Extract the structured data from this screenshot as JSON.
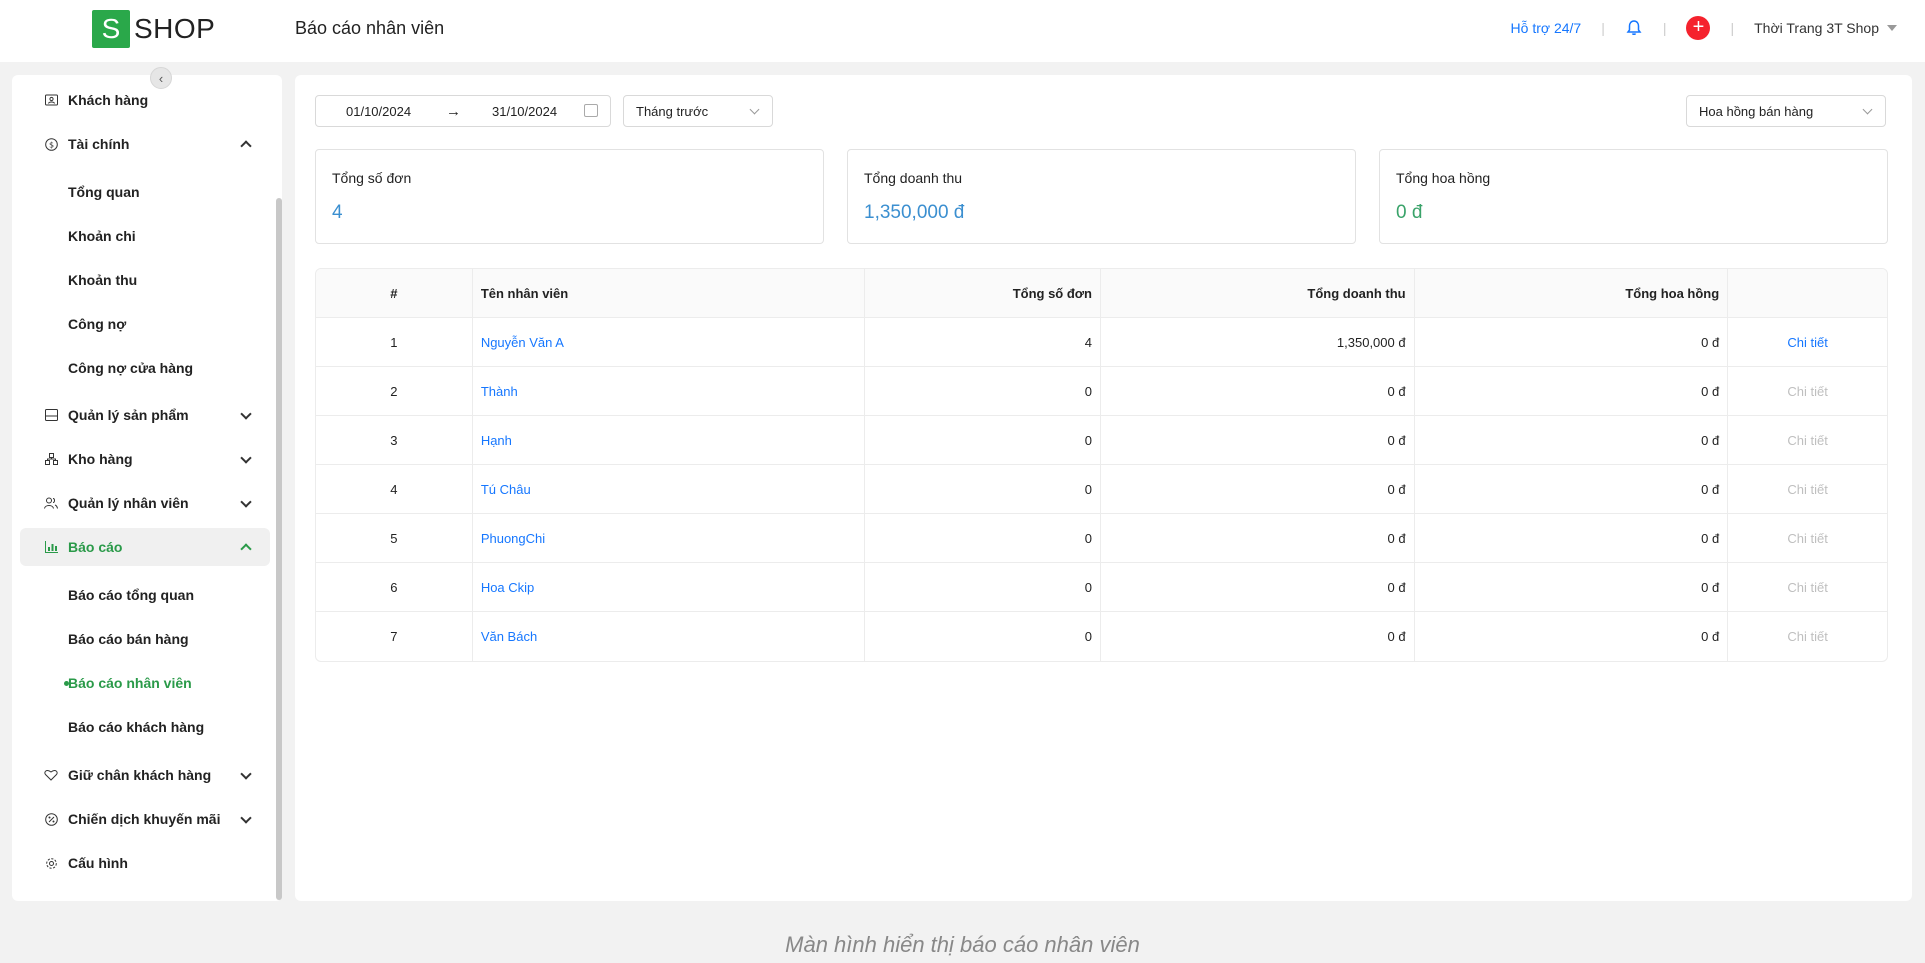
{
  "header": {
    "logo_letter": "S",
    "logo_text": "SHOP",
    "page_title": "Báo cáo nhân viên",
    "support": "Hỗ trợ 24/7",
    "separator": "|",
    "plus": "+",
    "shop_name": "Thời Trang 3T Shop"
  },
  "sidebar": {
    "items": [
      {
        "label": "Khách hàng",
        "icon": "contact-card-icon"
      },
      {
        "label": "Tài chính",
        "icon": "dollar-circle-icon"
      },
      {
        "label": "Quản lý sản phẩm",
        "icon": "box-icon"
      },
      {
        "label": "Kho hàng",
        "icon": "warehouse-icon"
      },
      {
        "label": "Quản lý nhân viên",
        "icon": "users-icon"
      },
      {
        "label": "Báo cáo",
        "icon": "bar-chart-icon"
      },
      {
        "label": "Giữ chân khách hàng",
        "icon": "heart-icon"
      },
      {
        "label": "Chiến dịch khuyến mãi",
        "icon": "percent-icon"
      },
      {
        "label": "Cấu hình",
        "icon": "gear-icon"
      }
    ],
    "finance_sub": [
      "Tổng quan",
      "Khoản chi",
      "Khoản thu",
      "Công nợ",
      "Công nợ cửa hàng"
    ],
    "report_sub": [
      "Báo cáo tổng quan",
      "Báo cáo bán hàng",
      "Báo cáo nhân viên",
      "Báo cáo khách hàng"
    ]
  },
  "filters": {
    "date_from": "01/10/2024",
    "date_to": "31/10/2024",
    "arrow": "→",
    "period": "Tháng trước",
    "report_type": "Hoa hồng bán hàng"
  },
  "stats": {
    "orders": {
      "label": "Tổng số đơn",
      "value": "4"
    },
    "revenue": {
      "label": "Tổng doanh thu",
      "value": "1,350,000 đ"
    },
    "commission": {
      "label": "Tổng hoa hồng",
      "value": "0 đ"
    }
  },
  "table": {
    "headers": {
      "idx": "#",
      "name": "Tên nhân viên",
      "orders": "Tổng số đơn",
      "revenue": "Tổng doanh thu",
      "commission": "Tổng hoa hồng"
    },
    "rows": [
      {
        "idx": "1",
        "name": "Nguyễn Văn A",
        "orders": "4",
        "revenue": "1,350,000 đ",
        "commission": "0 đ",
        "action": "Chi tiết"
      },
      {
        "idx": "2",
        "name": "Thành",
        "orders": "0",
        "revenue": "0 đ",
        "commission": "0 đ",
        "action": "Chi tiết"
      },
      {
        "idx": "3",
        "name": "Hạnh",
        "orders": "0",
        "revenue": "0 đ",
        "commission": "0 đ",
        "action": "Chi tiết"
      },
      {
        "idx": "4",
        "name": "Tú Châu",
        "orders": "0",
        "revenue": "0 đ",
        "commission": "0 đ",
        "action": "Chi tiết"
      },
      {
        "idx": "5",
        "name": "PhuongChi",
        "orders": "0",
        "revenue": "0 đ",
        "commission": "0 đ",
        "action": "Chi tiết"
      },
      {
        "idx": "6",
        "name": "Hoa Ckip",
        "orders": "0",
        "revenue": "0 đ",
        "commission": "0 đ",
        "action": "Chi tiết"
      },
      {
        "idx": "7",
        "name": "Văn Bách",
        "orders": "0",
        "revenue": "0 đ",
        "commission": "0 đ",
        "action": "Chi tiết"
      }
    ]
  },
  "caption": "Màn hình hiển thị báo cáo nhân viên",
  "colors": {
    "brand": "#2aa84a",
    "link": "#1677ff",
    "active": "#2a9a49",
    "revenue": "#3b8fd0",
    "commission": "#3aa36a"
  }
}
